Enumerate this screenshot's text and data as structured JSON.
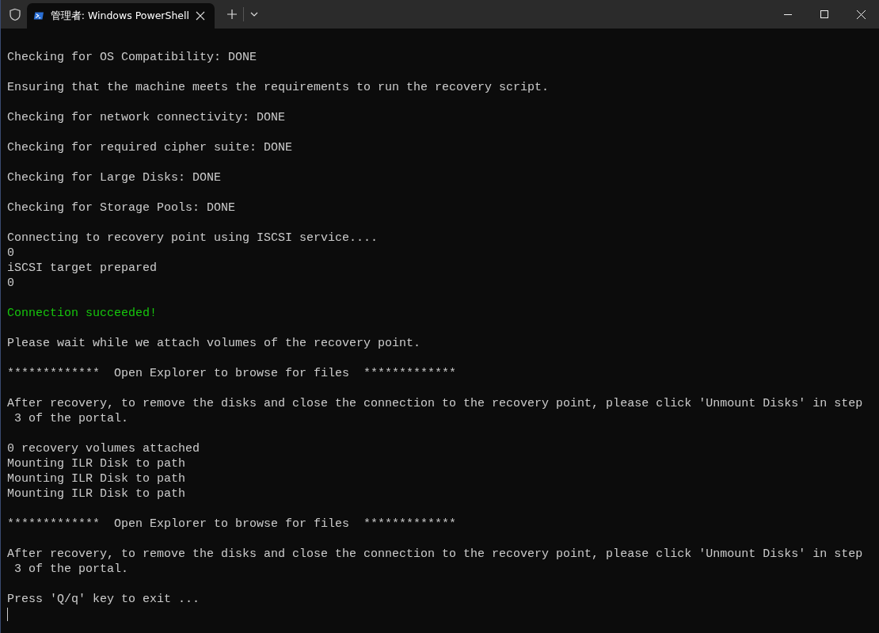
{
  "tab": {
    "title": "管理者: Windows PowerShell",
    "selected": true
  },
  "blocks": [
    {
      "lines": [
        {
          "kind": "normal",
          "text": "Checking for OS Compatibility: DONE"
        }
      ]
    },
    {
      "lines": [
        {
          "kind": "normal",
          "text": "Ensuring that the machine meets the requirements to run the recovery script."
        }
      ]
    },
    {
      "lines": [
        {
          "kind": "normal",
          "text": "Checking for network connectivity: DONE"
        }
      ]
    },
    {
      "lines": [
        {
          "kind": "normal",
          "text": "Checking for required cipher suite: DONE"
        }
      ]
    },
    {
      "lines": [
        {
          "kind": "normal",
          "text": "Checking for Large Disks: DONE"
        }
      ]
    },
    {
      "lines": [
        {
          "kind": "normal",
          "text": "Checking for Storage Pools: DONE"
        }
      ]
    },
    {
      "lines": [
        {
          "kind": "normal",
          "text": "Connecting to recovery point using ISCSI service...."
        },
        {
          "kind": "normal",
          "text": "0"
        },
        {
          "kind": "normal",
          "text": "iSCSI target prepared"
        },
        {
          "kind": "normal",
          "text": "0"
        }
      ]
    },
    {
      "lines": [
        {
          "kind": "success",
          "text": "Connection succeeded!"
        }
      ]
    },
    {
      "lines": [
        {
          "kind": "normal",
          "text": "Please wait while we attach volumes of the recovery point."
        }
      ]
    },
    {
      "lines": [
        {
          "kind": "normal",
          "text": "*************  Open Explorer to browse for files  *************"
        }
      ]
    },
    {
      "lines": [
        {
          "kind": "normal",
          "text": "After recovery, to remove the disks and close the connection to the recovery point, please click 'Unmount Disks' in step"
        },
        {
          "kind": "normal",
          "text": " 3 of the portal."
        }
      ]
    },
    {
      "lines": [
        {
          "kind": "normal",
          "text": "0 recovery volumes attached"
        },
        {
          "kind": "normal",
          "text": "Mounting ILR Disk to path"
        },
        {
          "kind": "normal",
          "text": "Mounting ILR Disk to path"
        },
        {
          "kind": "normal",
          "text": "Mounting ILR Disk to path"
        }
      ]
    },
    {
      "lines": [
        {
          "kind": "normal",
          "text": "*************  Open Explorer to browse for files  *************"
        }
      ]
    },
    {
      "lines": [
        {
          "kind": "normal",
          "text": "After recovery, to remove the disks and close the connection to the recovery point, please click 'Unmount Disks' in step"
        },
        {
          "kind": "normal",
          "text": " 3 of the portal."
        }
      ]
    },
    {
      "lines": [
        {
          "kind": "normal",
          "text": "Press 'Q/q' key to exit ..."
        }
      ]
    }
  ]
}
